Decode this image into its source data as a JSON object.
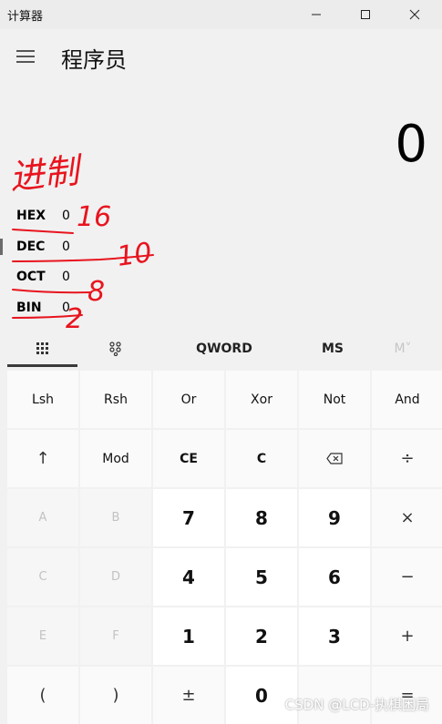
{
  "window": {
    "title": "计算器"
  },
  "header": {
    "mode_title": "程序员"
  },
  "display": {
    "value": "0"
  },
  "radix": [
    {
      "name": "HEX",
      "value": "0"
    },
    {
      "name": "DEC",
      "value": "0"
    },
    {
      "name": "OCT",
      "value": "0"
    },
    {
      "name": "BIN",
      "value": "0"
    }
  ],
  "toolbar": {
    "word_size": "QWORD",
    "ms": "MS",
    "mv": "M˅"
  },
  "keys": [
    [
      "Lsh",
      "Rsh",
      "Or",
      "Xor",
      "Not",
      "And"
    ],
    [
      "↑",
      "Mod",
      "CE",
      "C",
      "⌫",
      "÷"
    ],
    [
      "A",
      "B",
      "7",
      "8",
      "9",
      "×"
    ],
    [
      "C",
      "D",
      "4",
      "5",
      "6",
      "−"
    ],
    [
      "E",
      "F",
      "1",
      "2",
      "3",
      "+"
    ],
    [
      "(",
      ")",
      "±",
      "0",
      "",
      "="
    ]
  ],
  "annotations": {
    "heading": "进制",
    "hex_note": "16",
    "dec_note": "10",
    "oct_note": "8",
    "bin_note": "2"
  },
  "watermark": "CSDN @LCD-执棋困局",
  "colors": {
    "annotation": "#e8141e",
    "accent_bar": "#3a3a3a"
  }
}
